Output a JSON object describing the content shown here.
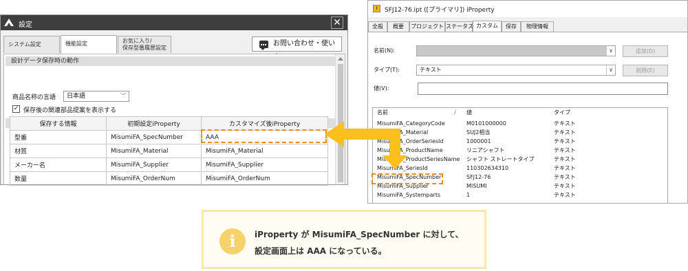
{
  "settings_window": {
    "title": "設定",
    "close_glyph": "✕",
    "tabs": [
      "システム設定",
      "機能設定",
      "お気に入り/",
      "保存型番履歴設定"
    ],
    "contact_button": "お問い合わせ・使い方",
    "section_save": "設計データ保存時の動作",
    "product_lang_label": "商品名称の言語",
    "product_lang_value": "日本語",
    "chevron": "﹀",
    "checkbox_mark": "✓",
    "checkbox_label": "保存後の関連部品提案を表示する",
    "section_iproperty": "iProperty",
    "table": {
      "headers": [
        "保存する情報",
        "初期設定iProperty",
        "カスタマイズ後iProperty"
      ],
      "rows": [
        [
          "型番",
          "MisumiFA_SpecNumber",
          "AAA"
        ],
        [
          "材質",
          "MisumiFA_Material",
          "MisumiFA_Material"
        ],
        [
          "メーカー名",
          "MisumiFA_Supplier",
          "MisumiFA_Supplier"
        ],
        [
          "数量",
          "MisumiFA_OrderNum",
          "MisumiFA_OrderNum"
        ]
      ]
    }
  },
  "iproperty_window": {
    "app_icon": "I",
    "title": "SFJ12-76.ipt ([プライマリ]) iProperty",
    "tabs": [
      "全般",
      "概要",
      "プロジェクト",
      "ステータス",
      "カスタム",
      "保存",
      "物理情報"
    ],
    "name_label": "名前(N):",
    "name_value": "",
    "add_button": "追加(D)",
    "type_label": "タイプ(T):",
    "type_value": "テキスト",
    "delete_button": "削除(E)",
    "value_label": "値(V):",
    "combo_chevron": "∨",
    "columns": [
      "名前",
      "値",
      "タイプ"
    ],
    "sort_glyph": "/",
    "rows": [
      [
        "MisumiFA_CategoryCode",
        "M0101000000",
        "テキスト"
      ],
      [
        "MisumiFA_Material",
        "SUJ2相当",
        "テキスト"
      ],
      [
        "MisumiFA_OrderSeriesId",
        "1000001",
        "テキスト"
      ],
      [
        "MisumiFA_ProductName",
        "リニアシャフト",
        "テキスト"
      ],
      [
        "MisumiFA_ProductSeriesName",
        "シャフト ストレートタイプ",
        "テキスト"
      ],
      [
        "MisumiFA_SeriesId",
        "110302634310",
        "テキスト"
      ],
      [
        "MisumiFA_SpecNumber",
        "SFJ12-76",
        "テキスト"
      ],
      [
        "MisumiFA_Supplier",
        "MISUMI",
        "テキスト"
      ],
      [
        "MisumiFA_Systemparts",
        "1",
        "テキスト"
      ]
    ]
  },
  "callout": {
    "icon": "i",
    "line1": "iProperty が MisumiFA_SpecNumber に対して、",
    "line2": "設定画面上は AAA になっている。"
  },
  "colors": {
    "highlight": "#f08c1a",
    "arrow": "#fbc01d",
    "callout_border": "#fbe9a4",
    "info_icon": "#f6d26a"
  }
}
